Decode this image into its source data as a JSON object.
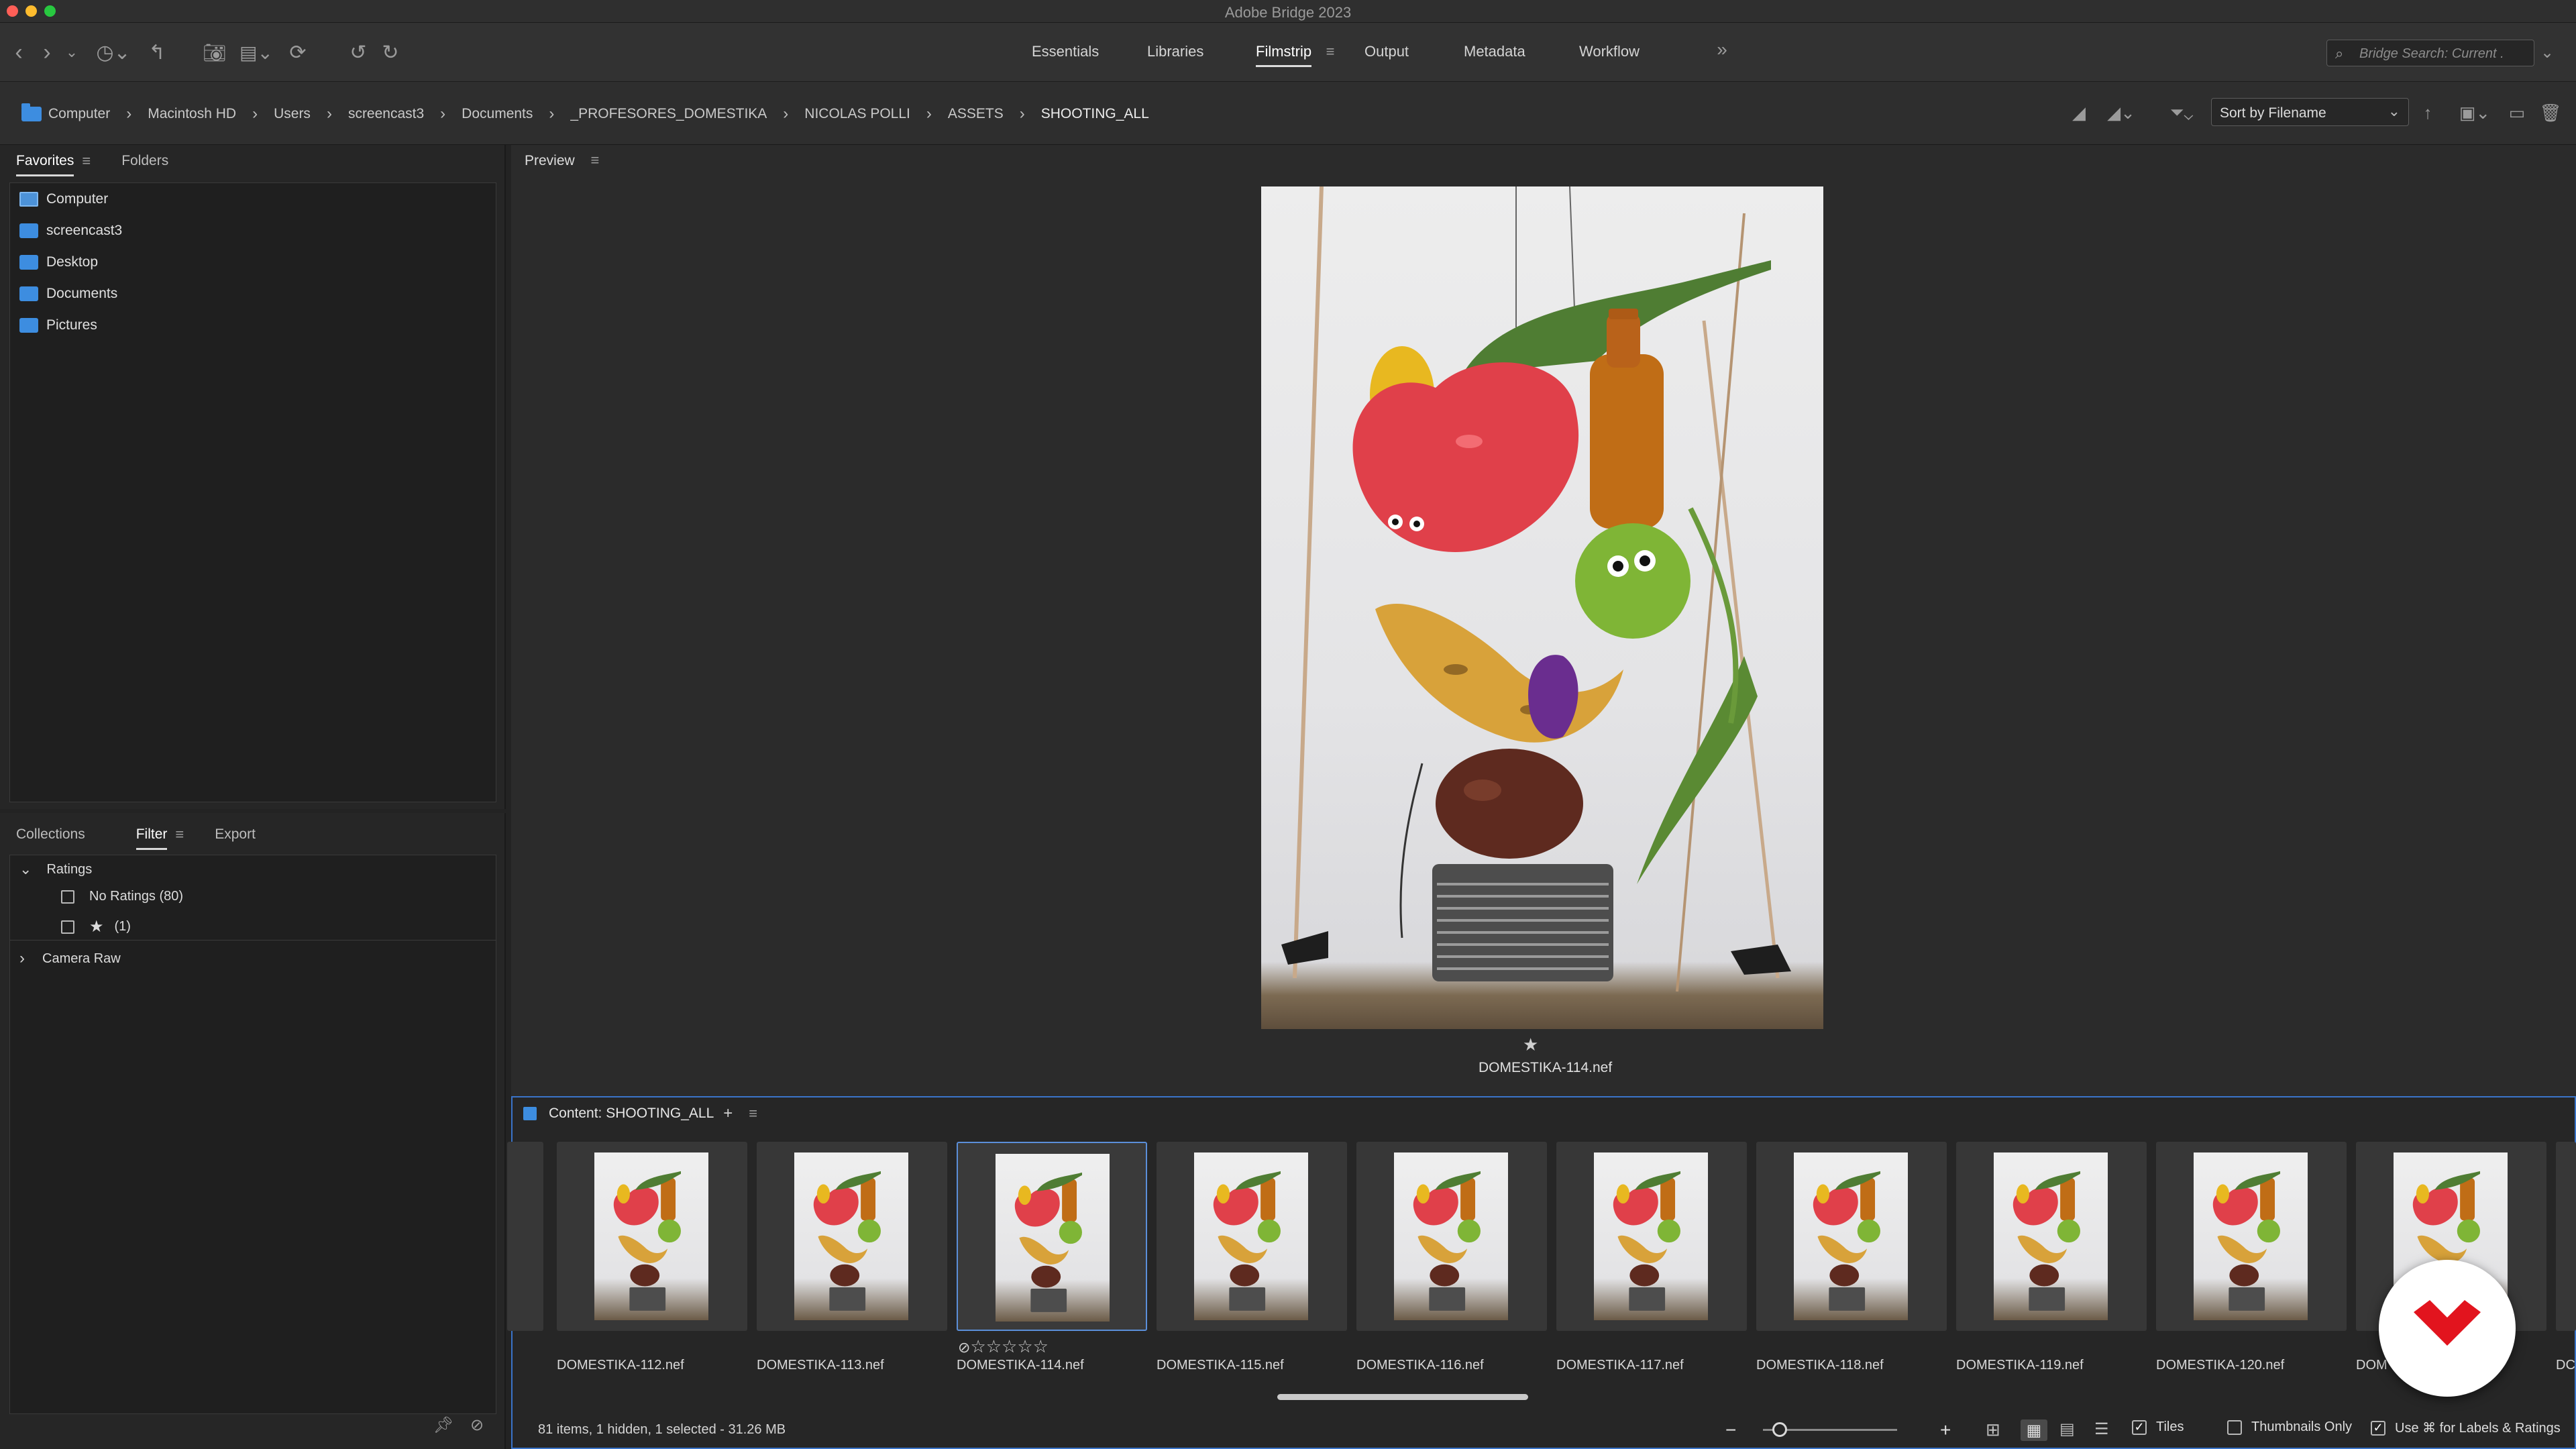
{
  "window": {
    "title": "Adobe Bridge 2023"
  },
  "workspaces": [
    "Essentials",
    "Libraries",
    "Filmstrip",
    "Output",
    "Metadata",
    "Workflow"
  ],
  "active_workspace": "Filmstrip",
  "search": {
    "placeholder": "Bridge Search: Current ."
  },
  "path": [
    "Computer",
    "Macintosh HD",
    "Users",
    "screencast3",
    "Documents",
    "_PROFESORES_DOMESTIKA",
    "NICOLAS POLLI",
    "ASSETS",
    "SHOOTING_ALL"
  ],
  "sort": {
    "label": "Sort by Filename"
  },
  "top_left_panel": {
    "tabs": [
      "Favorites",
      "Folders"
    ],
    "active": "Favorites"
  },
  "favorites": [
    "Computer",
    "screencast3",
    "Desktop",
    "Documents",
    "Pictures"
  ],
  "bottom_left_panel": {
    "tabs": [
      "Collections",
      "Filter",
      "Export"
    ],
    "active": "Filter"
  },
  "filter": {
    "ratings_label": "Ratings",
    "no_ratings": "No Ratings (80)",
    "one_star_count": "(1)",
    "camera_raw": "Camera Raw"
  },
  "preview": {
    "label": "Preview",
    "filename": "DOMESTIKA-114.nef",
    "rating_star": "★"
  },
  "content": {
    "title": "Content: SHOOTING_ALL",
    "thumbnails": [
      "DOMESTIKA-112.nef",
      "DOMESTIKA-113.nef",
      "DOMESTIKA-114.nef",
      "DOMESTIKA-115.nef",
      "DOMESTIKA-116.nef",
      "DOMESTIKA-117.nef",
      "DOMESTIKA-118.nef",
      "DOMESTIKA-119.nef",
      "DOMESTIKA-120.nef",
      "DOM",
      "DC"
    ],
    "selected_index": 2,
    "selected_rating_stars": "☆☆☆☆☆",
    "status": "81 items, 1 hidden, 1 selected - 31.26 MB",
    "tiles_label": "Tiles",
    "thumbnails_only_label": "Thumbnails Only",
    "labels_ratings_label": "Use ⌘ for Labels & Ratings"
  },
  "colors": {
    "accent": "#3d8de0",
    "selection": "#5b8fd9",
    "logo_red": "#e2141e"
  }
}
